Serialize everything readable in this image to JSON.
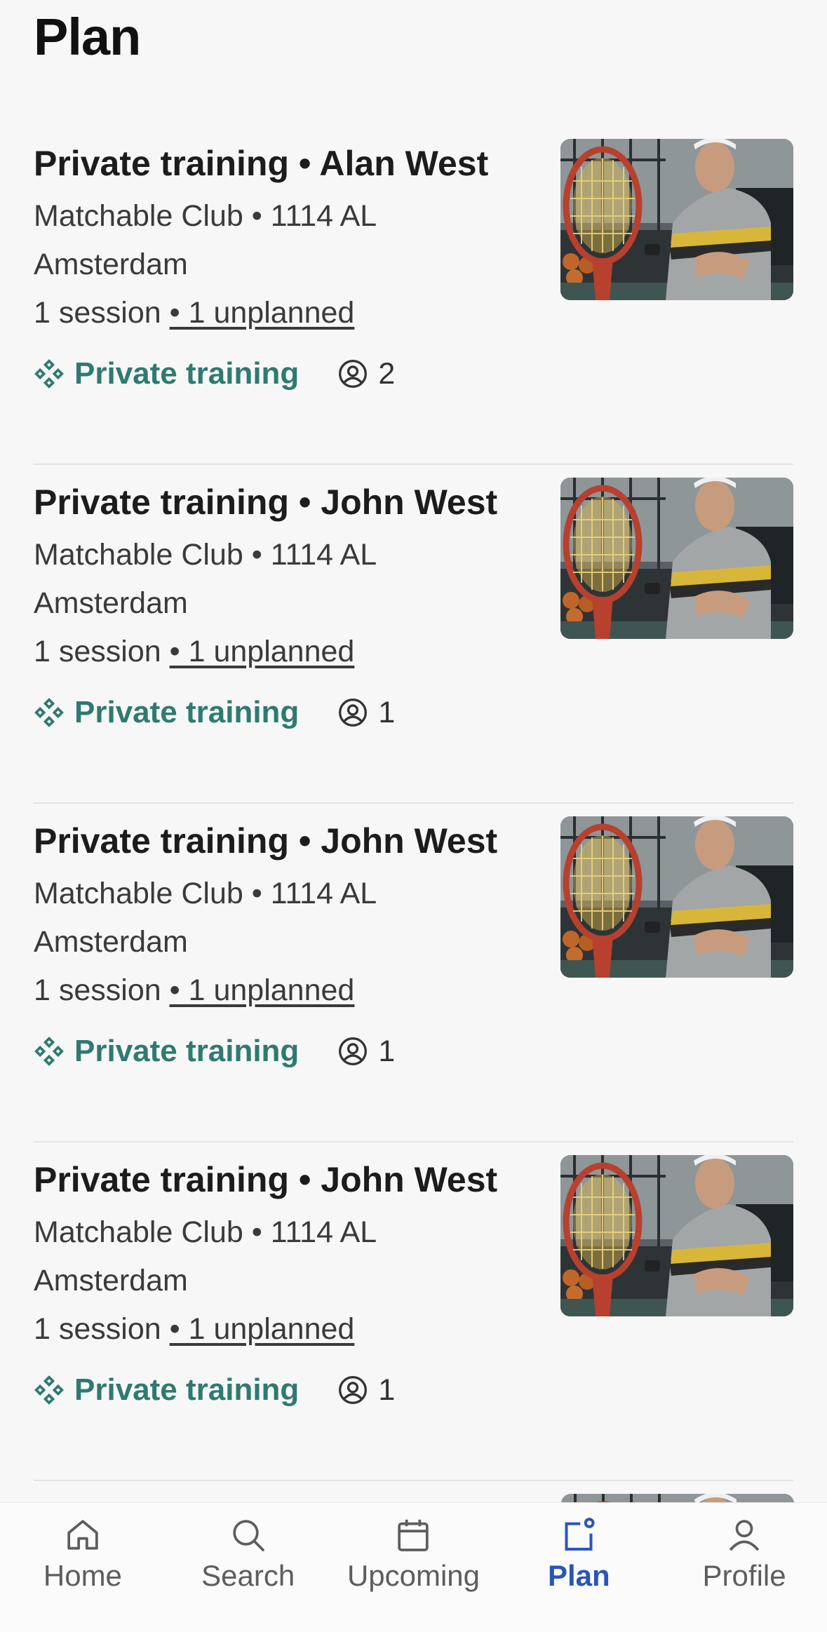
{
  "header": {
    "title": "Plan"
  },
  "cards": [
    {
      "title": "Private training • Alan West",
      "location": "Matchable Club • 1114 AL Amsterdam",
      "sessions": "1 session ",
      "unplanned": "• 1 unplanned",
      "tag": "Private training",
      "participants": "2"
    },
    {
      "title": "Private training • John West",
      "location": "Matchable Club • 1114 AL Amsterdam",
      "sessions": "1 session ",
      "unplanned": "• 1 unplanned",
      "tag": "Private training",
      "participants": "1"
    },
    {
      "title": "Private training • John West",
      "location": "Matchable Club • 1114 AL Amsterdam",
      "sessions": "1 session ",
      "unplanned": "• 1 unplanned",
      "tag": "Private training",
      "participants": "1"
    },
    {
      "title": "Private training • John West",
      "location": "Matchable Club • 1114 AL Amsterdam",
      "sessions": "1 session ",
      "unplanned": "• 1 unplanned",
      "tag": "Private training",
      "participants": "1"
    }
  ],
  "tabbar": {
    "items": [
      {
        "label": "Home",
        "icon": "home-icon"
      },
      {
        "label": "Search",
        "icon": "search-icon"
      },
      {
        "label": "Upcoming",
        "icon": "calendar-icon"
      },
      {
        "label": "Plan",
        "icon": "plan-icon",
        "active": true
      },
      {
        "label": "Profile",
        "icon": "profile-icon"
      }
    ]
  },
  "colors": {
    "accent": "#2f7a70",
    "active_tab": "#2a55b8",
    "background": "#f7f7f7"
  }
}
